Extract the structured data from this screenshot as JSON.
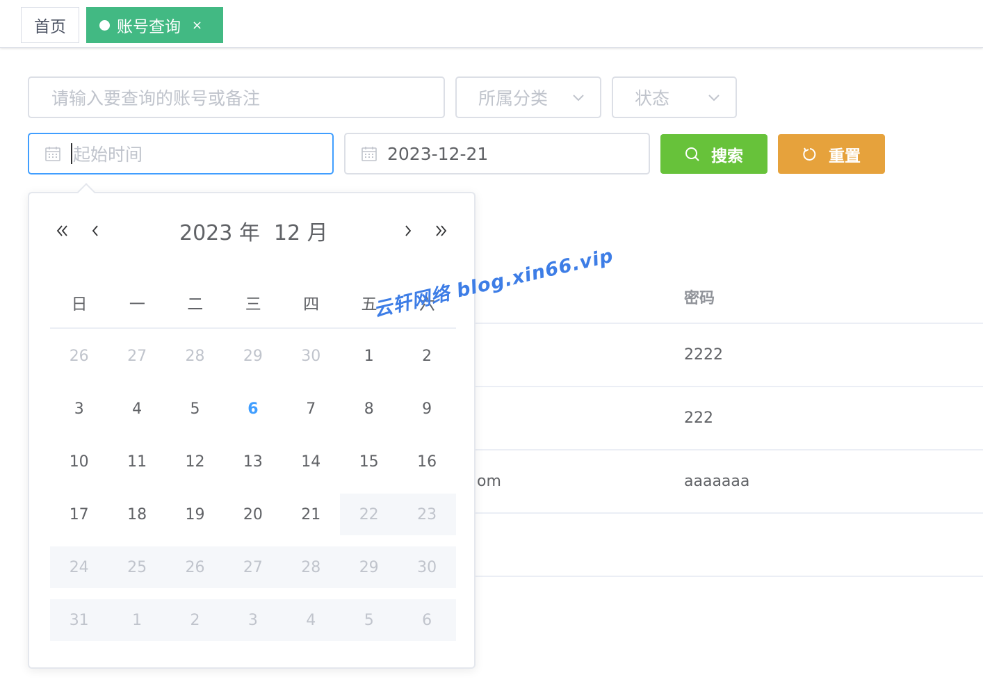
{
  "tags": {
    "home": "首页",
    "active": "账号查询",
    "close": "×"
  },
  "filters": {
    "search_placeholder": "请输入要查询的账号或备注",
    "category_placeholder": "所属分类",
    "status_placeholder": "状态",
    "start_placeholder": "起始时间",
    "end_value": "2023-12-21"
  },
  "buttons": {
    "search": "搜索",
    "reset": "重置"
  },
  "table": {
    "password_header": "密码",
    "rows": [
      {
        "account_fragment": "",
        "password": "2222"
      },
      {
        "account_fragment": "",
        "password": "222"
      },
      {
        "account_fragment": "om",
        "password": "aaaaaaa"
      },
      {
        "account_fragment": "",
        "password": ""
      }
    ]
  },
  "watermark": "云轩网络  blog.xin66.vip",
  "picker": {
    "year": "2023 年",
    "month": "12 月",
    "weekdays": [
      "日",
      "一",
      "二",
      "三",
      "四",
      "五",
      "六"
    ],
    "weeks": [
      [
        {
          "d": "26",
          "s": "other"
        },
        {
          "d": "27",
          "s": "other"
        },
        {
          "d": "28",
          "s": "other"
        },
        {
          "d": "29",
          "s": "other"
        },
        {
          "d": "30",
          "s": "other"
        },
        {
          "d": "1",
          "s": ""
        },
        {
          "d": "2",
          "s": ""
        }
      ],
      [
        {
          "d": "3",
          "s": ""
        },
        {
          "d": "4",
          "s": ""
        },
        {
          "d": "5",
          "s": ""
        },
        {
          "d": "6",
          "s": "today"
        },
        {
          "d": "7",
          "s": ""
        },
        {
          "d": "8",
          "s": ""
        },
        {
          "d": "9",
          "s": ""
        }
      ],
      [
        {
          "d": "10",
          "s": ""
        },
        {
          "d": "11",
          "s": ""
        },
        {
          "d": "12",
          "s": ""
        },
        {
          "d": "13",
          "s": ""
        },
        {
          "d": "14",
          "s": ""
        },
        {
          "d": "15",
          "s": ""
        },
        {
          "d": "16",
          "s": ""
        }
      ],
      [
        {
          "d": "17",
          "s": ""
        },
        {
          "d": "18",
          "s": ""
        },
        {
          "d": "19",
          "s": ""
        },
        {
          "d": "20",
          "s": ""
        },
        {
          "d": "21",
          "s": ""
        },
        {
          "d": "22",
          "s": "disabled"
        },
        {
          "d": "23",
          "s": "disabled"
        }
      ],
      [
        {
          "d": "24",
          "s": "disabled"
        },
        {
          "d": "25",
          "s": "disabled"
        },
        {
          "d": "26",
          "s": "disabled"
        },
        {
          "d": "27",
          "s": "disabled"
        },
        {
          "d": "28",
          "s": "disabled"
        },
        {
          "d": "29",
          "s": "disabled"
        },
        {
          "d": "30",
          "s": "disabled"
        }
      ],
      [
        {
          "d": "31",
          "s": "disabled"
        },
        {
          "d": "1",
          "s": "disabled"
        },
        {
          "d": "2",
          "s": "disabled"
        },
        {
          "d": "3",
          "s": "disabled"
        },
        {
          "d": "4",
          "s": "disabled"
        },
        {
          "d": "5",
          "s": "disabled"
        },
        {
          "d": "6",
          "s": "disabled"
        }
      ]
    ]
  },
  "colors": {
    "primary": "#409eff",
    "tag_active": "#42b983",
    "success": "#67c23a",
    "warning": "#e6a23c"
  },
  "icons": {
    "calendar": "calendar-icon",
    "search": "search-icon",
    "reset": "refresh-icon",
    "chevron": "chevron-down-icon",
    "prev_year": "double-chevron-left-icon",
    "prev_month": "chevron-left-icon",
    "next_month": "chevron-right-icon",
    "next_year": "double-chevron-right-icon"
  }
}
